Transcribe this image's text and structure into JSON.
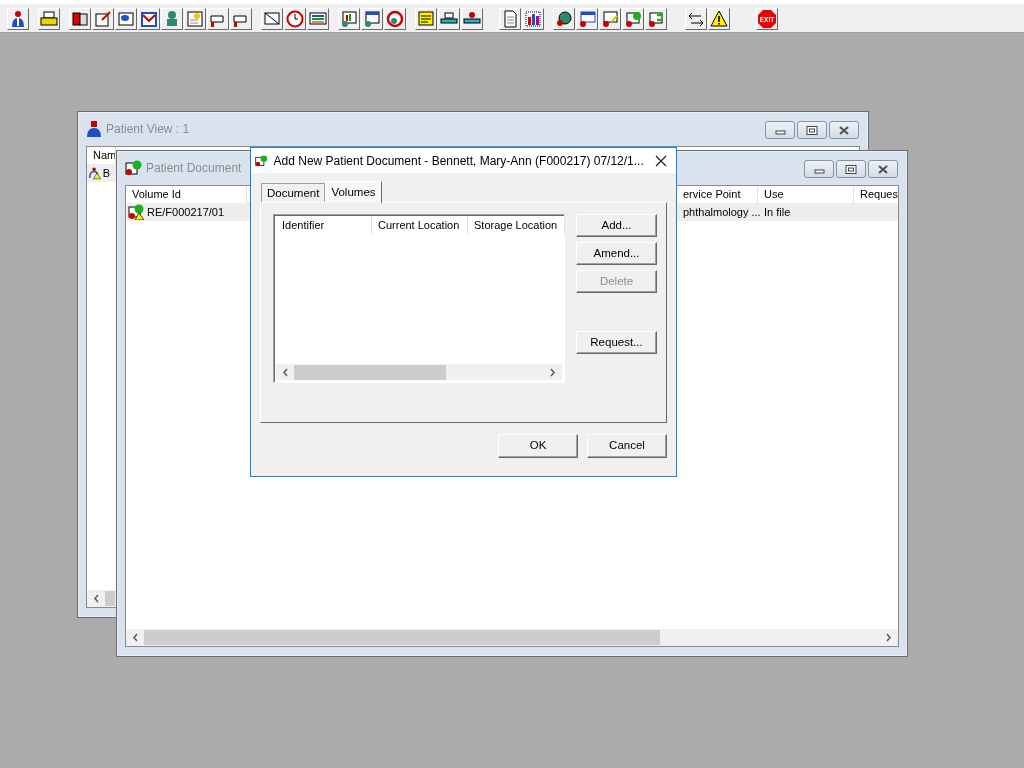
{
  "toolbar": {
    "exit_label": "EXIT"
  },
  "patient_view": {
    "title": "Patient View : 1",
    "columns": [
      {
        "label": "Nam"
      }
    ],
    "rows": [
      {
        "cells": [
          "B"
        ],
        "selected": true
      }
    ]
  },
  "document_view": {
    "title": "Patient Document",
    "columns": [
      {
        "label": "Volume Id"
      },
      {
        "label": "ervice Point"
      },
      {
        "label": "Use"
      },
      {
        "label": "Reques"
      }
    ],
    "rows": [
      {
        "cells": [
          "RE/F000217/01",
          "phthalmology ...",
          "In file"
        ],
        "selected": true
      }
    ]
  },
  "dialog": {
    "title": "Add New Patient Document - Bennett, Mary-Ann (F000217) 07/12/1...",
    "tabs": [
      {
        "label": "Document",
        "selected": false
      },
      {
        "label": "Volumes",
        "selected": true
      }
    ],
    "list_columns": [
      {
        "label": "Identifier"
      },
      {
        "label": "Current Location"
      },
      {
        "label": "Storage Location"
      }
    ],
    "side_buttons": [
      {
        "label": "Add...",
        "disabled": false
      },
      {
        "label": "Amend...",
        "disabled": false
      },
      {
        "label": "Delete",
        "disabled": true
      },
      {
        "label": "Request...",
        "disabled": false
      }
    ],
    "buttons": [
      {
        "label": "OK"
      },
      {
        "label": "Cancel"
      }
    ]
  }
}
